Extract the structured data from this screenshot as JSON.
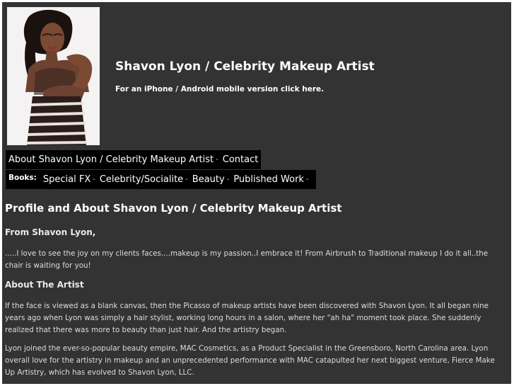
{
  "header": {
    "portrait_icon": "portrait-photo",
    "title": "Shavon Lyon / Celebrity Makeup Artist",
    "mobile_link": "For an iPhone / Android mobile version click here."
  },
  "nav": {
    "main_items": [
      {
        "label": "About Shavon Lyon / Celebrity Makeup Artist"
      },
      {
        "label": "Contact"
      }
    ],
    "books_label": "Books:",
    "book_items": [
      {
        "label": "Special FX"
      },
      {
        "label": "Celebrity/Socialite"
      },
      {
        "label": "Beauty"
      },
      {
        "label": "Published Work"
      }
    ],
    "separator": "-"
  },
  "content": {
    "title": "Profile and About Shavon Lyon / Celebrity Makeup Artist",
    "from_heading": "From Shavon Lyon,",
    "intro": ".....I love to see the joy on my clients faces....makeup is my passion..I embrace it! From Airbrush to Traditional makeup I do it all..the chair is waiting for you!",
    "about_heading": "About The Artist",
    "about_p1": "If the face is viewed as a blank canvas, then the Picasso of makeup artists have been discovered with Shavon Lyon. It all began nine years ago when Lyon was simply a hair stylist, working long hours in a salon, where her \"ah ha\" moment took place. She suddenly realized that there was more to beauty than just hair. And the artistry began.",
    "about_p2": "Lyon joined the ever-so-popular beauty empire, MAC Cosmetics, as a Product Specialist in the Greensboro, North Carolina area. Lyon overall love for the artistry in makeup and an unprecedented performance with MAC catapulted her next biggest venture, Fierce Make Up Artistry, which has evolved to Shavon Lyon, LLC."
  },
  "colors": {
    "background": "#333333",
    "nav_background": "#000000",
    "text": "#ffffff"
  }
}
